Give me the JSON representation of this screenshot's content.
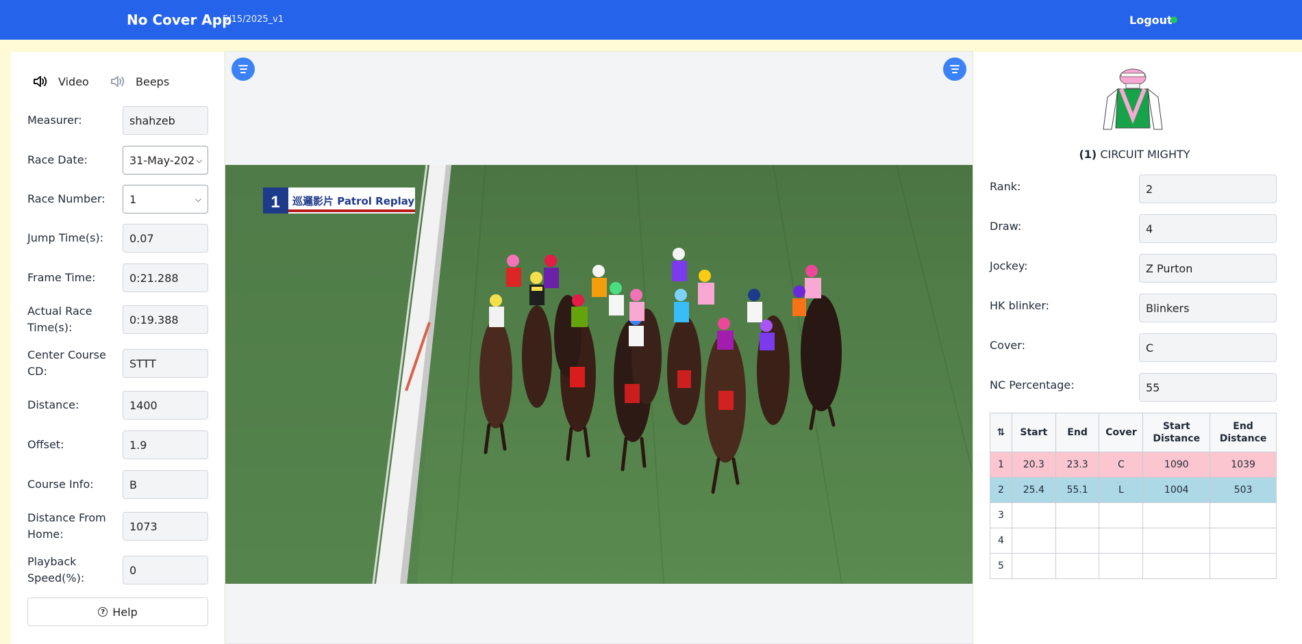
{
  "header": {
    "title": "No Cover App",
    "version": "5/15/2025_v1",
    "logout_label": "Logout",
    "status_color": "#22c55e",
    "bg_color": "#2563eb"
  },
  "controls": {
    "video_label": "Video",
    "beeps_label": "Beeps",
    "video_icon": "speaker-on-icon",
    "beeps_icon": "speaker-muted-icon"
  },
  "fields": {
    "measurer": {
      "label": "Measurer:",
      "value": "shahzeb"
    },
    "race_date": {
      "label": "Race Date:",
      "value": "31-May-202"
    },
    "race_number": {
      "label": "Race Number:",
      "value": "1"
    },
    "jump_time": {
      "label": "Jump Time(s):",
      "value": "0.07"
    },
    "frame_time": {
      "label": "Frame Time:",
      "value": "0:21.288"
    },
    "actual_race_time": {
      "label": "Actual Race Time(s):",
      "value": "0:19.388"
    },
    "center_course": {
      "label": "Center Course CD:",
      "value": "STTT"
    },
    "distance": {
      "label": "Distance:",
      "value": "1400"
    },
    "offset": {
      "label": "Offset:",
      "value": "1.9"
    },
    "course_info": {
      "label": "Course Info:",
      "value": "B"
    },
    "distance_from_home": {
      "label": "Distance From Home:",
      "value": "1073"
    },
    "playback_speed": {
      "label": "Playback Speed(%):",
      "value": "0"
    }
  },
  "help_label": "Help",
  "video": {
    "overlay_number": "1",
    "overlay_text": "巡邏影片 Patrol Replay"
  },
  "horse": {
    "number_label": "(1)",
    "name": "CIRCUIT MIGHTY",
    "silks_colors": {
      "cap": "#f9a8d4",
      "body": "#16a34a",
      "sleeves": "#ffffff",
      "sash": "#f9a8d4"
    }
  },
  "horse_fields": {
    "rank": {
      "label": "Rank:",
      "value": "2"
    },
    "draw": {
      "label": "Draw:",
      "value": "4"
    },
    "jockey": {
      "label": "Jockey:",
      "value": "Z Purton"
    },
    "hk_blinker": {
      "label": "HK blinker:",
      "value": "Blinkers"
    },
    "cover": {
      "label": "Cover:",
      "value": "C"
    },
    "nc_percentage": {
      "label": "NC Percentage:",
      "value": "55"
    }
  },
  "cover_table": {
    "headers": [
      "⇅",
      "Start",
      "End",
      "Cover",
      "Start Distance",
      "End Distance"
    ],
    "rows": [
      {
        "n": "1",
        "start": "20.3",
        "end": "23.3",
        "cover": "C",
        "start_distance": "1090",
        "end_distance": "1039",
        "color": "#fbc6d0"
      },
      {
        "n": "2",
        "start": "25.4",
        "end": "55.1",
        "cover": "L",
        "start_distance": "1004",
        "end_distance": "503",
        "color": "#add8e6"
      },
      {
        "n": "3",
        "start": "",
        "end": "",
        "cover": "",
        "start_distance": "",
        "end_distance": ""
      },
      {
        "n": "4",
        "start": "",
        "end": "",
        "cover": "",
        "start_distance": "",
        "end_distance": ""
      },
      {
        "n": "5",
        "start": "",
        "end": "",
        "cover": "",
        "start_distance": "",
        "end_distance": ""
      }
    ]
  }
}
